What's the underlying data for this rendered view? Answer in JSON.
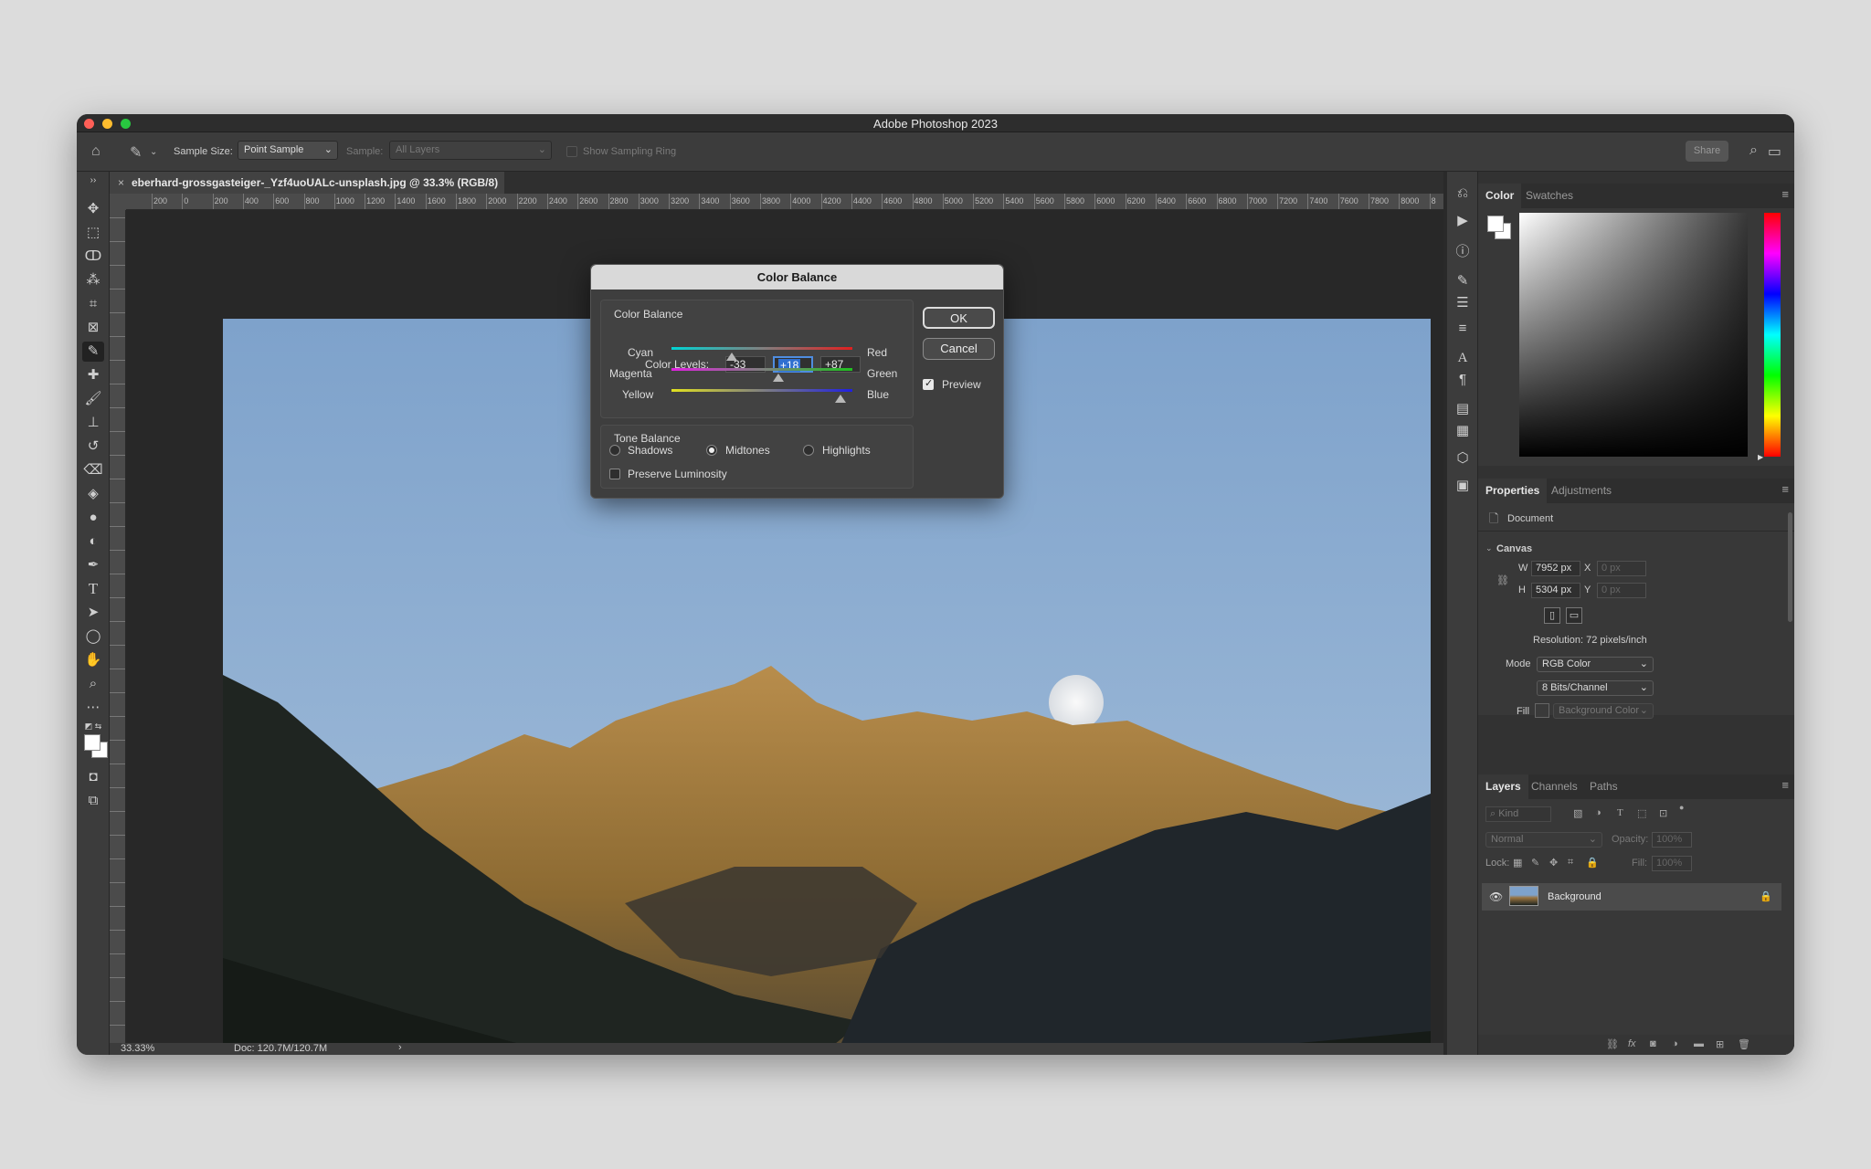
{
  "window": {
    "title": "Adobe Photoshop 2023"
  },
  "options_bar": {
    "sample_size_label": "Sample Size:",
    "sample_size_value": "Point Sample",
    "sample_label": "Sample:",
    "sample_value": "All Layers",
    "show_ring_label": "Show Sampling Ring",
    "share_label": "Share"
  },
  "document": {
    "tab_title": "eberhard-grossgasteiger-_Yzf4uoUALc-unsplash.jpg @ 33.3% (RGB/8)",
    "close_glyph": "×",
    "zoom": "33.33%",
    "doc_size": "Doc: 120.7M/120.7M",
    "status_arrow": "›"
  },
  "ruler": {
    "h_ticks": [
      "200",
      "0",
      "200",
      "400",
      "600",
      "800",
      "1000",
      "1200",
      "1400",
      "1600",
      "1800",
      "2000",
      "2200",
      "2400",
      "2600",
      "2800",
      "3000",
      "3200",
      "3400",
      "3600",
      "3800",
      "4000",
      "4200",
      "4400",
      "4600",
      "4800",
      "5000",
      "5200",
      "5400",
      "5600",
      "5800",
      "6000",
      "6200",
      "6400",
      "6600",
      "6800",
      "7000",
      "7200",
      "7400",
      "7600",
      "7800",
      "8000",
      "8"
    ]
  },
  "dialog": {
    "title": "Color Balance",
    "group1_title": "Color Balance",
    "levels_label": "Color Levels:",
    "level1": "-33",
    "level2": "+18",
    "level3": "+87",
    "rows": [
      {
        "left": "Cyan",
        "right": "Red",
        "value": -33
      },
      {
        "left": "Magenta",
        "right": "Green",
        "value": 18
      },
      {
        "left": "Yellow",
        "right": "Blue",
        "value": 87
      }
    ],
    "slider_range": [
      -100,
      100
    ],
    "group2_title": "Tone Balance",
    "shadows": "Shadows",
    "midtones": "Midtones",
    "highlights": "Highlights",
    "preserve": "Preserve Luminosity",
    "ok": "OK",
    "cancel": "Cancel",
    "preview": "Preview"
  },
  "color_panel": {
    "tab1": "Color",
    "tab2": "Swatches",
    "hue_color": "#ff0000"
  },
  "properties": {
    "tab1": "Properties",
    "tab2": "Adjustments",
    "document_label": "Document",
    "canvas_label": "Canvas",
    "w_label": "W",
    "w_value": "7952 px",
    "h_label": "H",
    "h_value": "5304 px",
    "x_label": "X",
    "x_value": "0 px",
    "y_label": "Y",
    "y_value": "0 px",
    "resolution": "Resolution: 72 pixels/inch",
    "mode_label": "Mode",
    "mode_value": "RGB Color",
    "bits_value": "8 Bits/Channel",
    "fill_label": "Fill",
    "fill_value": "Background Color"
  },
  "layers": {
    "tab1": "Layers",
    "tab2": "Channels",
    "tab3": "Paths",
    "kind_placeholder": "Kind",
    "blend_mode": "Normal",
    "opacity_label": "Opacity:",
    "opacity_value": "100%",
    "lock_label": "Lock:",
    "fill_label": "Fill:",
    "fill_value": "100%",
    "items": [
      {
        "name": "Background"
      }
    ]
  }
}
